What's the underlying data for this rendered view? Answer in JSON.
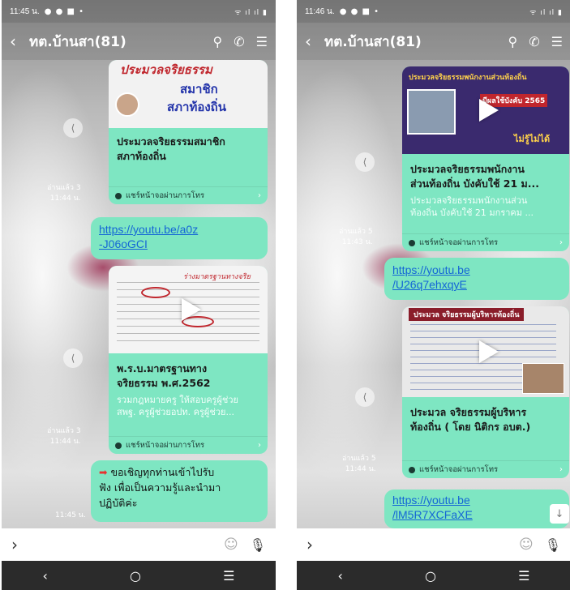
{
  "left": {
    "status_time": "11:45 น.",
    "chat_title": "ทต.บ้านสา(81)",
    "card1": {
      "thumb_banner": "ประมวลจริยธรรม",
      "thumb_text_line1": "สมาชิก",
      "thumb_text_line2": "สภาท้องถิ่น",
      "title_line1": "ประมวลจริยธรรมสมาชิก",
      "title_line2": "สภาท้องถิ่น",
      "footer": "แชร์หน้าจอผ่านการโทร"
    },
    "read1": {
      "status": "อ่านแล้ว 3",
      "time": "11:44 น."
    },
    "link1": {
      "line1": "https://youtu.be/a0z",
      "line2": "-J06oGCI"
    },
    "card2": {
      "thumb_handwriting": "ร่างมาตรฐานทางจริย",
      "title_line1": "พ.ร.บ.มาตรฐานทาง",
      "title_line2": "จริยธรรม พ.ศ.2562",
      "desc_line1": "รวมกฎหมายครู ให้สอบครูผู้ช่วย",
      "desc_line2": "สพฐ. ครูผู้ช่วยอปท. ครูผู้ช่วย...",
      "footer": "แชร์หน้าจอผ่านการโทร"
    },
    "read2": {
      "status": "อ่านแล้ว 3",
      "time": "11:44 น."
    },
    "text_msg": {
      "line1": "ขอเชิญทุกท่านเข้าไปรับ",
      "line2": "ฟัง เพื่อเป็นความรู้และนำมา",
      "line3": "ปฏิบัติค่ะ"
    },
    "text_msg_time": "11:45 น."
  },
  "right": {
    "status_time": "11:46 น.",
    "chat_title": "ทต.บ้านสา(81)",
    "card1": {
      "thumb_banner": "ประมวลจริยธรรมพนักงานส่วนท้องถิ่น",
      "thumb_sub": "มีผลใช้บังคับ 2565",
      "thumb_caption": "ไม่รู้ไม่ได้",
      "title_line1": "ประมวลจริยธรรมพนักงาน",
      "title_line2": "ส่วนท้องถิ่น บังคับใช้ 21 ม...",
      "desc_line1": "ประมวลจริยธรรมพนักงานส่วน",
      "desc_line2": "ท้องถิ่น บังคับใช้ 21 มกราคม ...",
      "footer": "แชร์หน้าจอผ่านการโทร"
    },
    "read1": {
      "status": "อ่านแล้ว 5",
      "time": "11:43 น."
    },
    "link1": {
      "line1": "https://youtu.be",
      "line2": "/U26q7ehxqyE"
    },
    "card2": {
      "thumb_banner": "ประมวล จริยธรรมผู้บริหารท้องถิ่น",
      "title_line1": "ประมวล จริยธรรมผู้บริหาร",
      "title_line2": "ท้องถิ่น ( โดย นิติกร อบต.)",
      "footer": "แชร์หน้าจอผ่านการโทร"
    },
    "read2": {
      "status": "อ่านแล้ว 5",
      "time": "11:44 น."
    },
    "link2": {
      "line1": "https://youtu.be",
      "line2": "/lM5R7XCFaXE"
    }
  },
  "colors": {
    "bubble": "#7ee6c2",
    "link": "#1466d6",
    "navbar": "#2b2b2b"
  },
  "icons": {
    "back": "chevron-left-icon",
    "search": "search-icon",
    "phone": "phone-icon",
    "menu": "menu-icon",
    "share": "share-icon",
    "play": "play-icon",
    "emoji": "emoji-icon",
    "mic": "microphone-icon",
    "expand": "chevron-right-icon",
    "scroll_down": "arrow-down-icon"
  }
}
